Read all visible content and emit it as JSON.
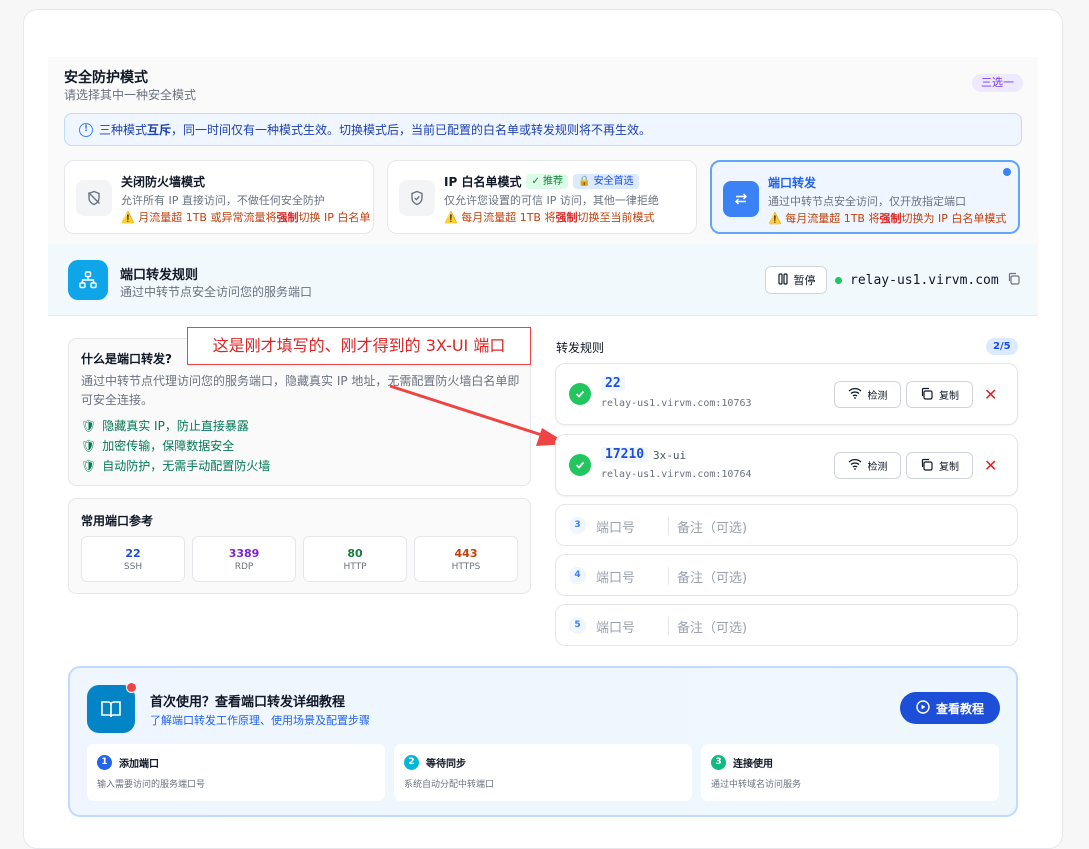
{
  "security": {
    "title": "安全防护模式",
    "subtitle": "请选择其中一种安全模式",
    "badge": "三选一",
    "notice_prefix": "三种模式",
    "notice_strong": "互斥",
    "notice_rest": "，同一时间仅有一种模式生效。切换模式后，当前已配置的白名单或转发规则将不再生效。",
    "modes": [
      {
        "title": "关闭防火墙模式",
        "desc": "允许所有 IP 直接访问，不做任何安全防护",
        "warn_a": "⚠️ 月流量超 1TB 或异常流量将",
        "warn_b": "强制",
        "warn_c": "切换 IP 白名单",
        "icon": "shield-off-icon"
      },
      {
        "title": "IP 白名单模式",
        "tag1": "推荐",
        "tag2": "安全首选",
        "desc": "仅允许您设置的可信 IP 访问，其他一律拒绝",
        "warn_a": "⚠️ 每月流量超 1TB 将",
        "warn_b": "强制",
        "warn_c": "切换至当前模式",
        "icon": "shield-check-icon"
      },
      {
        "title": "端口转发",
        "desc": "通过中转节点安全访问，仅开放指定端口",
        "warn_a": "⚠️ 每月流量超 1TB 将",
        "warn_b": "强制",
        "warn_c": "切换为 IP 白名单模式",
        "icon": "swap-arrows-icon"
      }
    ]
  },
  "forward": {
    "title": "端口转发规则",
    "subtitle": "通过中转节点安全访问您的服务端口",
    "pause_label": "暂停",
    "relay_host": "relay-us1.virvm.com"
  },
  "info": {
    "title": "什么是端口转发?",
    "desc": "通过中转节点代理访问您的服务端口，隐藏真实 IP 地址，无需配置防火墙白名单即可安全连接。",
    "checks": [
      "隐藏真实 IP，防止直接暴露",
      "加密传输，保障数据安全",
      "自动防护，无需手动配置防火墙"
    ]
  },
  "common_ports": {
    "title": "常用端口参考",
    "items": [
      {
        "port": "22",
        "name": "SSH",
        "color": "#1d4ed8"
      },
      {
        "port": "3389",
        "name": "RDP",
        "color": "#7e22ce"
      },
      {
        "port": "80",
        "name": "HTTP",
        "color": "#15803d"
      },
      {
        "port": "443",
        "name": "HTTPS",
        "color": "#c2410c"
      }
    ]
  },
  "annotation": "这是刚才填写的、刚才得到的 3X-UI 端口",
  "rules": {
    "title": "转发规则",
    "count": "2/5",
    "check_label": "检测",
    "copy_label": "复制",
    "items": [
      {
        "port": "22",
        "note": "",
        "addr": "relay-us1.virvm.com:10763"
      },
      {
        "port": "17210",
        "note": "3x-ui",
        "addr": "relay-us1.virvm.com:10764"
      }
    ],
    "empty": [
      {
        "num": "3",
        "port_ph": "端口号",
        "note_ph": "备注（可选)"
      },
      {
        "num": "4",
        "port_ph": "端口号",
        "note_ph": "备注（可选)"
      },
      {
        "num": "5",
        "port_ph": "端口号",
        "note_ph": "备注（可选)"
      }
    ]
  },
  "tutorial": {
    "title": "首次使用？查看端口转发详细教程",
    "subtitle": "了解端口转发工作原理、使用场景及配置步骤",
    "button": "查看教程",
    "steps": [
      {
        "num": "1",
        "title": "添加端口",
        "desc": "输入需要访问的服务端口号",
        "color": "#2563eb"
      },
      {
        "num": "2",
        "title": "等待同步",
        "desc": "系统自动分配中转端口",
        "color": "#06b6d4"
      },
      {
        "num": "3",
        "title": "连接使用",
        "desc": "通过中转域名访问服务",
        "color": "#10b981"
      }
    ]
  }
}
